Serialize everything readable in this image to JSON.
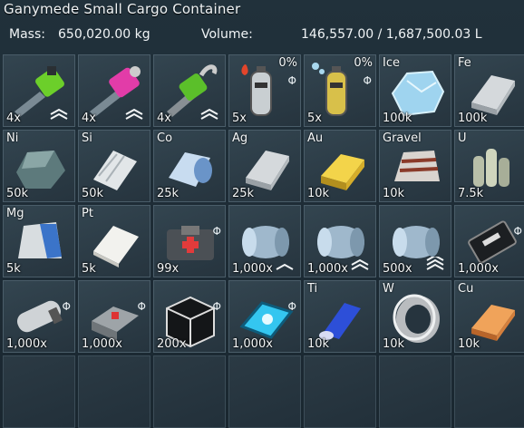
{
  "window": {
    "title": "Ganymede Small Cargo Container"
  },
  "stats": {
    "mass_label": "Mass:",
    "mass_value": "650,020.00 kg",
    "volume_label": "Volume:",
    "volume_value": "146,557.00 / 1,687,500.03 L"
  },
  "slots": [
    {
      "name": "welder-tool",
      "icon": "welder-icon",
      "qty": "4x",
      "symbol": "",
      "percent": "",
      "phi": false,
      "tier": 2
    },
    {
      "name": "grinder-tool",
      "icon": "grinder-icon",
      "qty": "4x",
      "symbol": "",
      "percent": "",
      "phi": false,
      "tier": 2
    },
    {
      "name": "drill-tool",
      "icon": "drill-icon",
      "qty": "4x",
      "symbol": "",
      "percent": "",
      "phi": false,
      "tier": 2
    },
    {
      "name": "hydrogen-bottle",
      "icon": "hydrogen-bottle-icon",
      "qty": "5x",
      "symbol": "",
      "percent": "0%",
      "phi": true,
      "tier": 0
    },
    {
      "name": "oxygen-bottle",
      "icon": "oxygen-bottle-icon",
      "qty": "5x",
      "symbol": "",
      "percent": "0%",
      "phi": true,
      "tier": 0
    },
    {
      "name": "ice",
      "icon": "ice-icon",
      "qty": "100k",
      "symbol": "Ice",
      "percent": "",
      "phi": false,
      "tier": 0
    },
    {
      "name": "iron-ingot",
      "icon": "ingot-icon",
      "qty": "100k",
      "symbol": "Fe",
      "percent": "",
      "phi": false,
      "tier": 0
    },
    {
      "name": "nickel-ore",
      "icon": "ore-icon",
      "qty": "50k",
      "symbol": "Ni",
      "percent": "",
      "phi": false,
      "tier": 0
    },
    {
      "name": "silicon-wafer",
      "icon": "silicon-icon",
      "qty": "50k",
      "symbol": "Si",
      "percent": "",
      "phi": false,
      "tier": 0
    },
    {
      "name": "cobalt-ingot",
      "icon": "cobalt-icon",
      "qty": "25k",
      "symbol": "Co",
      "percent": "",
      "phi": false,
      "tier": 0
    },
    {
      "name": "silver-ingot",
      "icon": "ingot-icon",
      "qty": "25k",
      "symbol": "Ag",
      "percent": "",
      "phi": false,
      "tier": 0
    },
    {
      "name": "gold-ingot",
      "icon": "gold-ingot-icon",
      "qty": "10k",
      "symbol": "Au",
      "percent": "",
      "phi": false,
      "tier": 0
    },
    {
      "name": "gravel",
      "icon": "gravel-sack-icon",
      "qty": "10k",
      "symbol": "Gravel",
      "percent": "",
      "phi": false,
      "tier": 0
    },
    {
      "name": "uranium-ingot",
      "icon": "uranium-rods-icon",
      "qty": "7.5k",
      "symbol": "U",
      "percent": "",
      "phi": false,
      "tier": 0
    },
    {
      "name": "magnesium-powder",
      "icon": "powder-sack-icon",
      "qty": "5k",
      "symbol": "Mg",
      "percent": "",
      "phi": false,
      "tier": 0
    },
    {
      "name": "platinum-ingot",
      "icon": "platinum-icon",
      "qty": "5k",
      "symbol": "Pt",
      "percent": "",
      "phi": false,
      "tier": 0
    },
    {
      "name": "medical-component",
      "icon": "medkit-box-icon",
      "qty": "99x",
      "symbol": "",
      "percent": "",
      "phi": true,
      "tier": 0
    },
    {
      "name": "component-canister-1",
      "icon": "canister-icon",
      "qty": "1,000x",
      "symbol": "",
      "percent": "",
      "phi": false,
      "tier": 1
    },
    {
      "name": "component-canister-2",
      "icon": "canister-icon",
      "qty": "1,000x",
      "symbol": "",
      "percent": "",
      "phi": false,
      "tier": 2
    },
    {
      "name": "component-canister-3",
      "icon": "canister-icon",
      "qty": "500x",
      "symbol": "",
      "percent": "",
      "phi": false,
      "tier": 3
    },
    {
      "name": "computer-component",
      "icon": "computer-chip-icon",
      "qty": "1,000x",
      "symbol": "",
      "percent": "",
      "phi": true,
      "tier": 0
    },
    {
      "name": "motor-component",
      "icon": "motor-icon",
      "qty": "1,000x",
      "symbol": "",
      "percent": "",
      "phi": true,
      "tier": 0
    },
    {
      "name": "construction-component",
      "icon": "crate-icon",
      "qty": "1,000x",
      "symbol": "",
      "percent": "",
      "phi": true,
      "tier": 0
    },
    {
      "name": "girder-component",
      "icon": "girder-cube-icon",
      "qty": "200x",
      "symbol": "",
      "percent": "",
      "phi": true,
      "tier": 0
    },
    {
      "name": "display-component",
      "icon": "display-panel-icon",
      "qty": "1,000x",
      "symbol": "",
      "percent": "",
      "phi": true,
      "tier": 0
    },
    {
      "name": "titanium-ingot",
      "icon": "titanium-icon",
      "qty": "10k",
      "symbol": "Ti",
      "percent": "",
      "phi": false,
      "tier": 0
    },
    {
      "name": "tungsten-ingot",
      "icon": "tungsten-ring-icon",
      "qty": "10k",
      "symbol": "W",
      "percent": "",
      "phi": false,
      "tier": 0
    },
    {
      "name": "copper-ingot",
      "icon": "copper-ingot-icon",
      "qty": "10k",
      "symbol": "Cu",
      "percent": "",
      "phi": false,
      "tier": 0
    },
    {
      "name": "empty-slot",
      "icon": "",
      "qty": "",
      "symbol": "",
      "percent": "",
      "phi": false,
      "tier": 0
    },
    {
      "name": "empty-slot",
      "icon": "",
      "qty": "",
      "symbol": "",
      "percent": "",
      "phi": false,
      "tier": 0
    },
    {
      "name": "empty-slot",
      "icon": "",
      "qty": "",
      "symbol": "",
      "percent": "",
      "phi": false,
      "tier": 0
    },
    {
      "name": "empty-slot",
      "icon": "",
      "qty": "",
      "symbol": "",
      "percent": "",
      "phi": false,
      "tier": 0
    },
    {
      "name": "empty-slot",
      "icon": "",
      "qty": "",
      "symbol": "",
      "percent": "",
      "phi": false,
      "tier": 0
    },
    {
      "name": "empty-slot",
      "icon": "",
      "qty": "",
      "symbol": "",
      "percent": "",
      "phi": false,
      "tier": 0
    },
    {
      "name": "empty-slot",
      "icon": "",
      "qty": "",
      "symbol": "",
      "percent": "",
      "phi": false,
      "tier": 0
    }
  ],
  "phi_glyph": "Φ",
  "colors": {
    "panel": "#1d2a33",
    "slot_border": "#4a5d69",
    "text": "#f0f4f6"
  }
}
